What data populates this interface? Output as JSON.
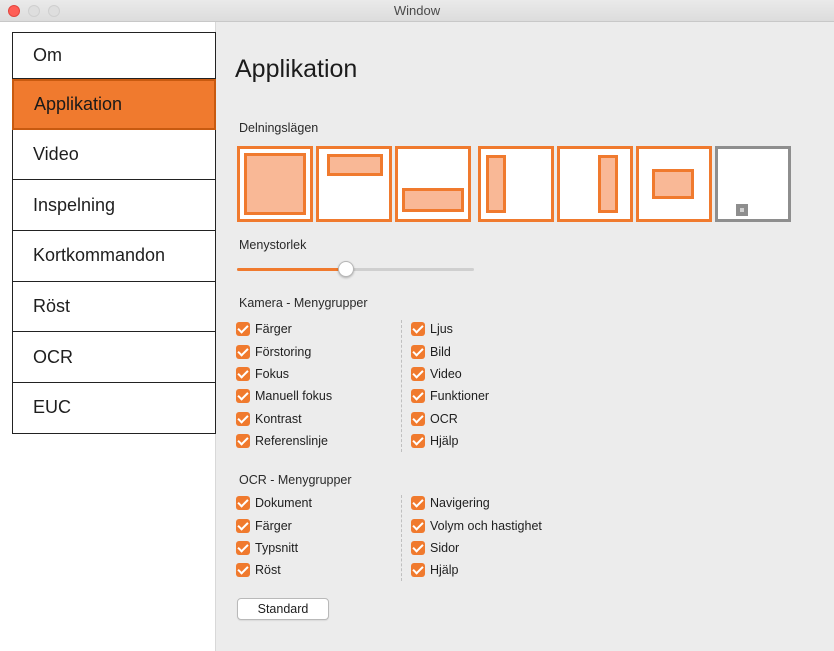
{
  "window": {
    "title": "Window"
  },
  "colors": {
    "accent": "#f07a2e",
    "accent_light": "#f9b896",
    "disabled": "#8e8e8e"
  },
  "sidebar": {
    "items": [
      {
        "label": "Om",
        "selected": false
      },
      {
        "label": "Applikation",
        "selected": true
      },
      {
        "label": "Video",
        "selected": false
      },
      {
        "label": "Inspelning",
        "selected": false
      },
      {
        "label": "Kortkommandon",
        "selected": false
      },
      {
        "label": "Röst",
        "selected": false
      },
      {
        "label": "OCR",
        "selected": false
      },
      {
        "label": "EUC",
        "selected": false
      }
    ]
  },
  "main": {
    "title": "Applikation",
    "split_modes": {
      "label": "Delningslägen",
      "options": [
        {
          "name": "fullscreen",
          "selected": true
        },
        {
          "name": "top",
          "selected": true
        },
        {
          "name": "bottom",
          "selected": true
        },
        {
          "name": "left",
          "selected": true
        },
        {
          "name": "right",
          "selected": true
        },
        {
          "name": "center",
          "selected": true
        },
        {
          "name": "corner",
          "selected": false
        }
      ]
    },
    "menu_size": {
      "label": "Menystorlek",
      "value": 0.46
    },
    "camera_groups": {
      "label": "Kamera - Menygrupper",
      "left": [
        {
          "label": "Färger",
          "checked": true
        },
        {
          "label": "Förstoring",
          "checked": true
        },
        {
          "label": "Fokus",
          "checked": true
        },
        {
          "label": "Manuell fokus",
          "checked": true
        },
        {
          "label": "Kontrast",
          "checked": true
        },
        {
          "label": "Referenslinje",
          "checked": true
        }
      ],
      "right": [
        {
          "label": "Ljus",
          "checked": true
        },
        {
          "label": "Bild",
          "checked": true
        },
        {
          "label": "Video",
          "checked": true
        },
        {
          "label": "Funktioner",
          "checked": true
        },
        {
          "label": "OCR",
          "checked": true
        },
        {
          "label": "Hjälp",
          "checked": true
        }
      ]
    },
    "ocr_groups": {
      "label": "OCR - Menygrupper",
      "left": [
        {
          "label": "Dokument",
          "checked": true
        },
        {
          "label": "Färger",
          "checked": true
        },
        {
          "label": "Typsnitt",
          "checked": true
        },
        {
          "label": "Röst",
          "checked": true
        }
      ],
      "right": [
        {
          "label": "Navigering",
          "checked": true
        },
        {
          "label": "Volym och hastighet",
          "checked": true
        },
        {
          "label": "Sidor",
          "checked": true
        },
        {
          "label": "Hjälp",
          "checked": true
        }
      ]
    },
    "default_button": "Standard"
  }
}
